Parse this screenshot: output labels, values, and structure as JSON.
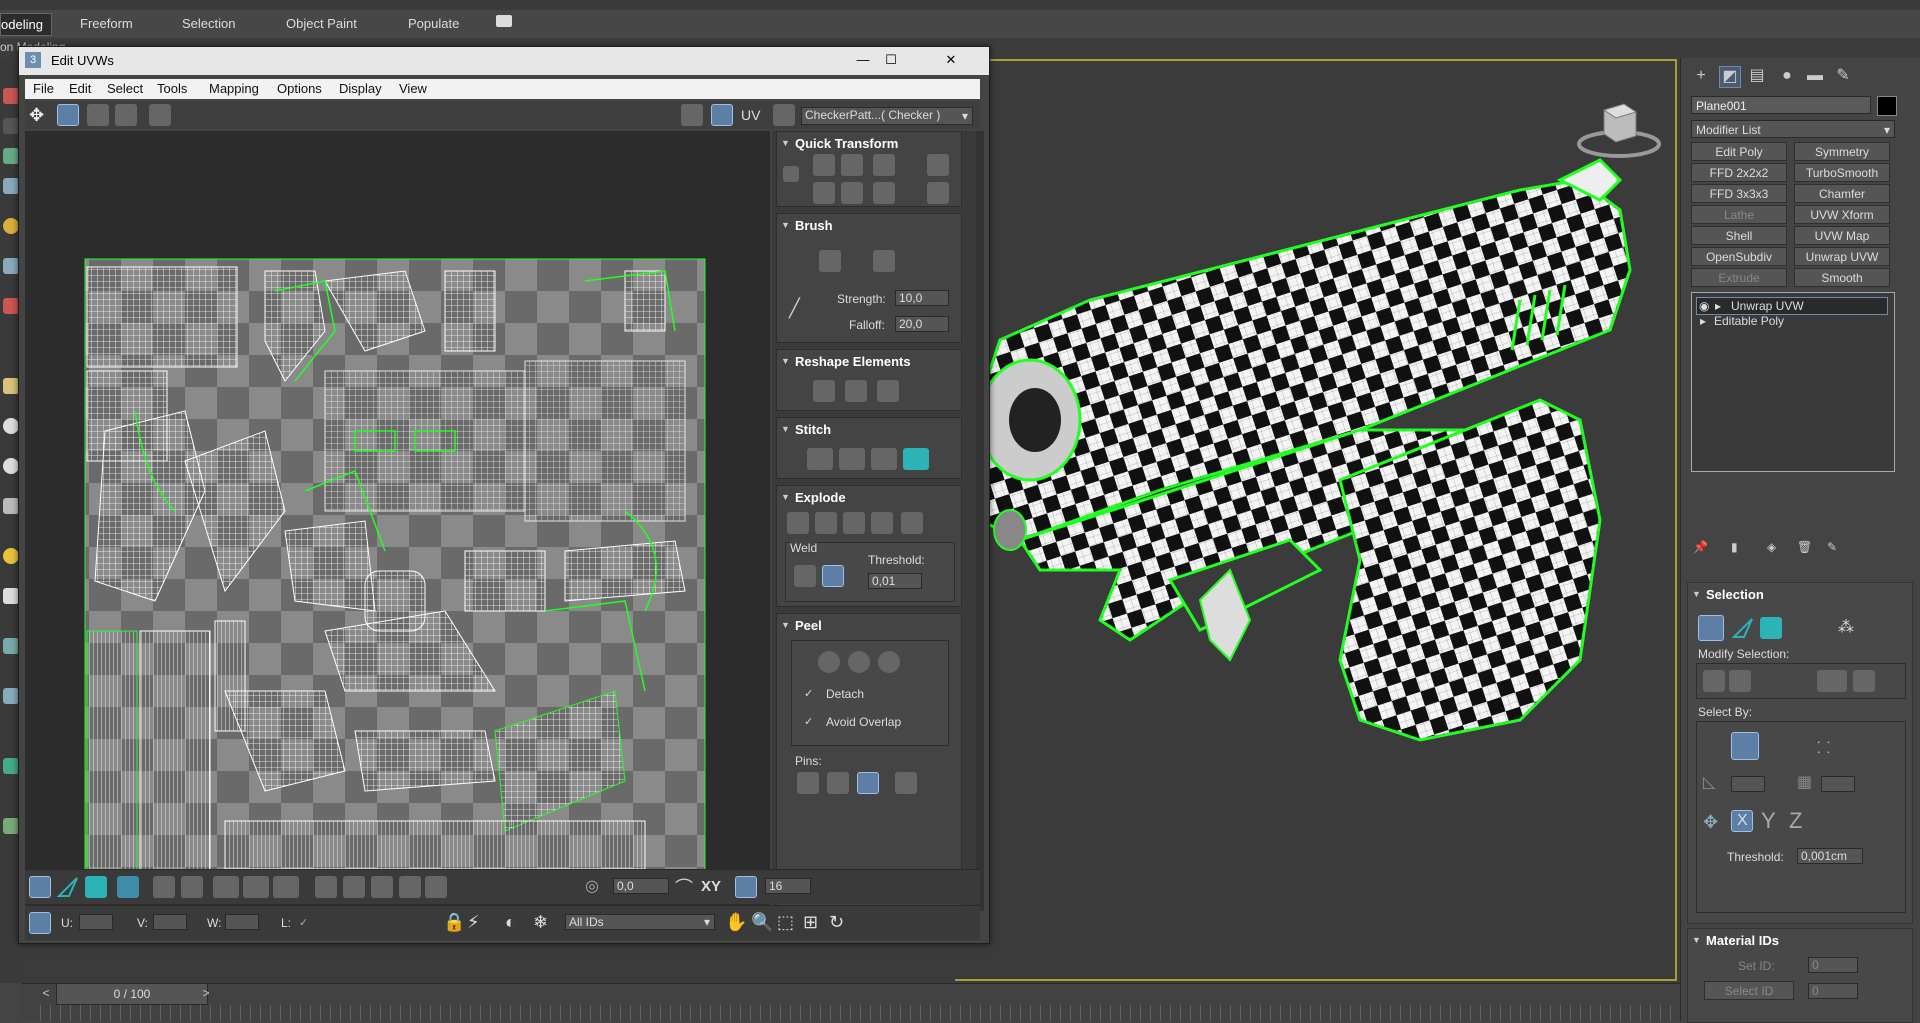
{
  "ribbon": {
    "tabs": [
      "odeling",
      "Freeform",
      "Selection",
      "Object Paint",
      "Populate"
    ],
    "sub_label": "on Modeling"
  },
  "uvw": {
    "title": "Edit UVWs",
    "title_icon": "3",
    "menu": [
      "File",
      "Edit",
      "Select",
      "Tools",
      "Mapping",
      "Options",
      "Display",
      "View"
    ],
    "uv_label": "UV",
    "texture_dropdown": "CheckerPatt...( Checker )",
    "panels": {
      "quick_transform": "Quick Transform",
      "brush": "Brush",
      "strength_label": "Strength:",
      "strength_value": "10,0",
      "falloff_label": "Falloff:",
      "falloff_value": "20,0",
      "reshape": "Reshape Elements",
      "stitch": "Stitch",
      "explode": "Explode",
      "weld_label": "Weld",
      "threshold_label": "Threshold:",
      "threshold_value": "0,01",
      "peel": "Peel",
      "detach_label": "Detach",
      "avoid_overlap_label": "Avoid Overlap",
      "pins_label": "Pins:"
    },
    "bottom": {
      "rotation_value": "0,0",
      "xy_label": "XY",
      "grid_value": "16",
      "u_label": "U:",
      "v_label": "V:",
      "w_label": "W:",
      "l_label": "L:",
      "ids_dropdown": "All IDs"
    }
  },
  "command_panel": {
    "object_name": "Plane001",
    "modifier_list": "Modifier List",
    "modifier_buttons": [
      [
        "Edit Poly",
        "Symmetry"
      ],
      [
        "FFD 2x2x2",
        "TurboSmooth"
      ],
      [
        "FFD 3x3x3",
        "Chamfer"
      ],
      [
        "Lathe",
        "UVW Xform"
      ],
      [
        "Shell",
        "UVW Map"
      ],
      [
        "OpenSubdiv",
        "Unwrap UVW"
      ],
      [
        "Extrude",
        "Smooth"
      ]
    ],
    "stack": [
      "Unwrap UVW",
      "Editable Poly"
    ],
    "selection_title": "Selection",
    "modify_selection": "Modify Selection:",
    "select_by": "Select By:",
    "threshold_label": "Threshold:",
    "threshold_value": "0,001cm",
    "material_ids_title": "Material IDs",
    "set_id_label": "Set ID:",
    "set_id_value": "0",
    "select_id_label": "Select ID",
    "select_id_value": "0"
  },
  "timeline": {
    "frame": "0 / 100"
  },
  "colors": {
    "accent": "#2bb3b8",
    "wire_green": "#22ff22",
    "viewport_border": "#b29a34",
    "selection_blue": "#5d7fa5"
  }
}
